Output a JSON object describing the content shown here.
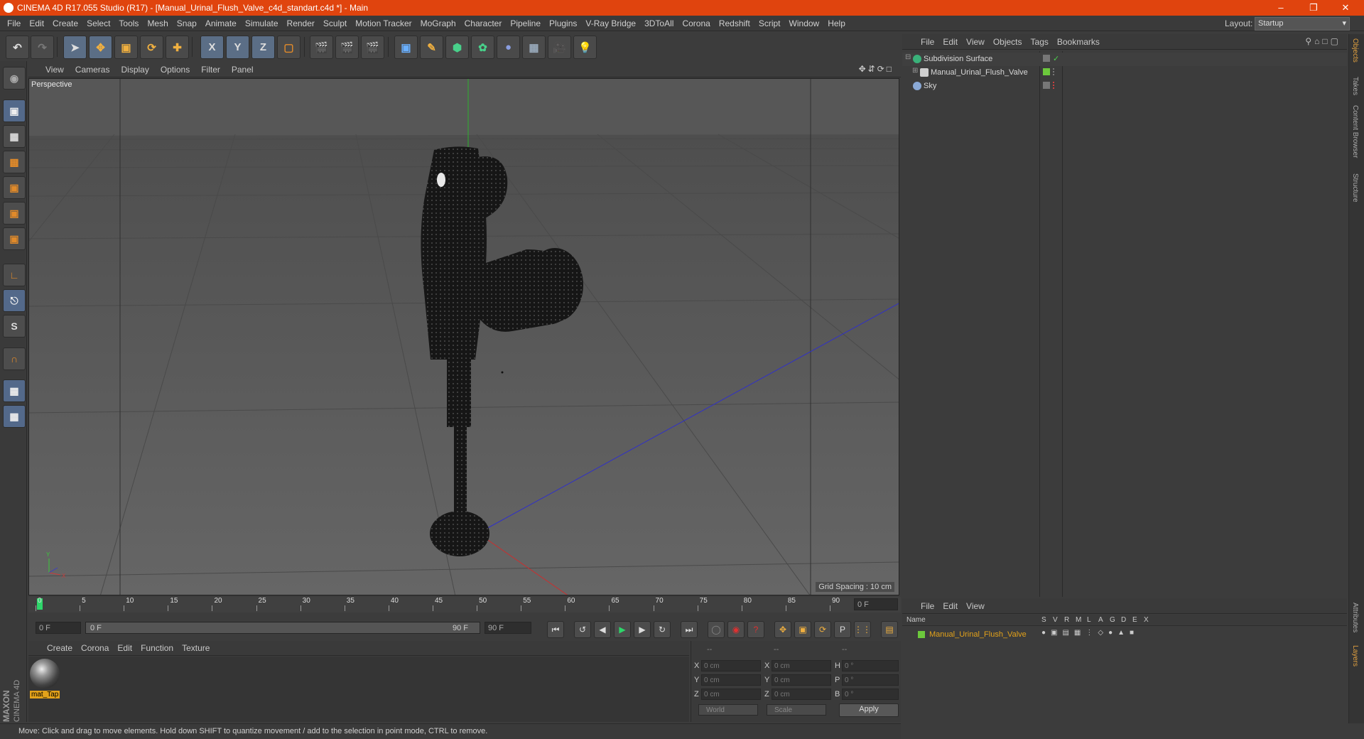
{
  "window": {
    "title": "CINEMA 4D R17.055 Studio (R17) - [Manual_Urinal_Flush_Valve_c4d_standart.c4d *] - Main"
  },
  "menubar": {
    "items": [
      "File",
      "Edit",
      "Create",
      "Select",
      "Tools",
      "Mesh",
      "Snap",
      "Animate",
      "Simulate",
      "Render",
      "Sculpt",
      "Motion Tracker",
      "MoGraph",
      "Character",
      "Pipeline",
      "Plugins",
      "V-Ray Bridge",
      "3DToAll",
      "Corona",
      "Redshift",
      "Script",
      "Window",
      "Help"
    ],
    "layout_label": "Layout:",
    "layout_value": "Startup"
  },
  "toolbar": {
    "axis_x": "X",
    "axis_y": "Y",
    "axis_z": "Z"
  },
  "viewport": {
    "menu": [
      "View",
      "Cameras",
      "Display",
      "Options",
      "Filter",
      "Panel"
    ],
    "label": "Perspective",
    "grid_spacing": "Grid Spacing : 10 cm"
  },
  "timeline": {
    "ticks": [
      "0",
      "5",
      "10",
      "15",
      "20",
      "25",
      "30",
      "35",
      "40",
      "45",
      "50",
      "55",
      "60",
      "65",
      "70",
      "75",
      "80",
      "85",
      "90"
    ],
    "current_frame": "0 F",
    "start_field": "0 F",
    "slider_start": "0 F",
    "slider_end": "90 F",
    "end_field": "90 F"
  },
  "material_manager": {
    "menu": [
      "Create",
      "Corona",
      "Edit",
      "Function",
      "Texture"
    ],
    "material_name": "mat_Tap"
  },
  "coordinates": {
    "headers": [
      "--",
      "--",
      "--"
    ],
    "rows": [
      {
        "a": "X",
        "av": "0 cm",
        "b": "X",
        "bv": "0 cm",
        "c": "H",
        "cv": "0 °"
      },
      {
        "a": "Y",
        "av": "0 cm",
        "b": "Y",
        "bv": "0 cm",
        "c": "P",
        "cv": "0 °"
      },
      {
        "a": "Z",
        "av": "0 cm",
        "b": "Z",
        "bv": "0 cm",
        "c": "B",
        "cv": "0 °"
      }
    ],
    "space": "World",
    "mode": "Scale",
    "apply": "Apply"
  },
  "status": {
    "text": "Move: Click and drag to move elements. Hold down SHIFT to quantize movement / add to the selection in point mode, CTRL to remove."
  },
  "brand": {
    "line1": "MAXON",
    "line2": "CINEMA 4D"
  },
  "object_manager": {
    "menu": [
      "File",
      "Edit",
      "View",
      "Objects",
      "Tags",
      "Bookmarks"
    ],
    "objects": [
      {
        "name": "Subdivision Surface",
        "icon_color": "#3ab27a"
      },
      {
        "name": "Manual_Urinal_Flush_Valve",
        "icon_color": "#cfcfcf"
      },
      {
        "name": "Sky",
        "icon_color": "#8aa9d6"
      }
    ]
  },
  "side_tabs": [
    "Objects",
    "Takes",
    "Content Browser",
    "Structure",
    "Attributes",
    "Layers"
  ],
  "layer_manager": {
    "menu": [
      "File",
      "Edit",
      "View"
    ],
    "columns": [
      "Name",
      "S",
      "V",
      "R",
      "M",
      "L",
      "A",
      "G",
      "D",
      "E",
      "X"
    ],
    "layers": [
      {
        "name": "Manual_Urinal_Flush_Valve",
        "color": "#6cc83c"
      }
    ]
  }
}
